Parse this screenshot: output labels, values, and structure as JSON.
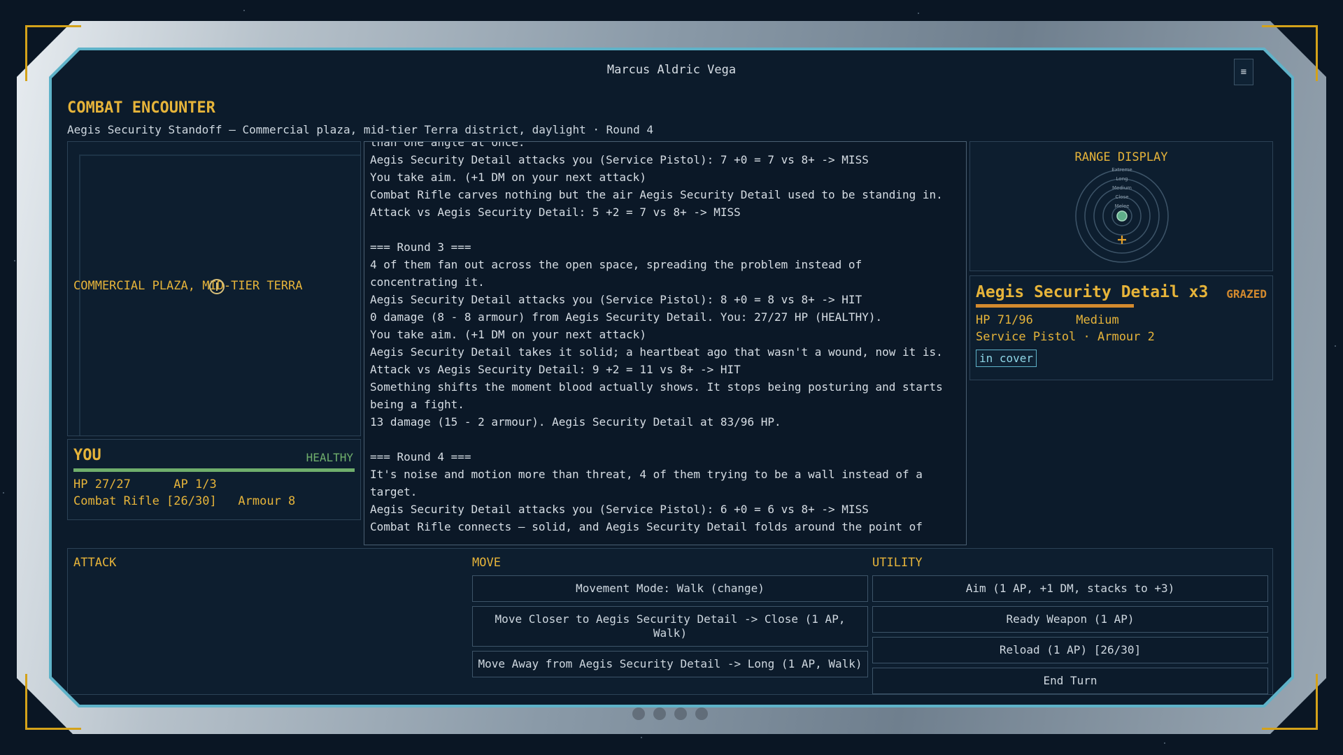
{
  "window": {
    "title": "Marcus Aldric Vega",
    "menu_glyph": "≡"
  },
  "encounter": {
    "title": "COMBAT ENCOUNTER",
    "subtitle": "Aegis Security Standoff — Commercial plaza, mid-tier Terra district, daylight · Round 4"
  },
  "map": {
    "label": "COMMERCIAL PLAZA, MID-TIER TERRA"
  },
  "player": {
    "title": "YOU",
    "status": "HEALTHY",
    "hp_fraction": 1.0,
    "line1": "HP 27/27      AP 1/3",
    "line2": "Combat Rifle [26/30]   Armour 8"
  },
  "log": [
    "than one angle at once.",
    "Aegis Security Detail attacks you (Service Pistol): 7 +0 = 7 vs 8+ -> MISS",
    "You take aim. (+1 DM on your next attack)",
    "Combat Rifle carves nothing but the air Aegis Security Detail used to be standing in.",
    "Attack vs Aegis Security Detail: 5 +2 = 7 vs 8+ -> MISS",
    "",
    "=== Round 3 ===",
    "4 of them fan out across the open space, spreading the problem instead of concentrating it.",
    "Aegis Security Detail attacks you (Service Pistol): 8 +0 = 8 vs 8+ -> HIT",
    "0 damage (8 - 8 armour) from Aegis Security Detail. You: 27/27 HP (HEALTHY).",
    "You take aim. (+1 DM on your next attack)",
    "Aegis Security Detail takes it solid; a heartbeat ago that wasn't a wound, now it is.",
    "Attack vs Aegis Security Detail: 9 +2 = 11 vs 8+ -> HIT",
    "Something shifts the moment blood actually shows. It stops being posturing and starts being a fight.",
    "13 damage (15 - 2 armour). Aegis Security Detail at 83/96 HP.",
    "",
    "=== Round 4 ===",
    "It's noise and motion more than threat, 4 of them trying to be a wall instead of a target.",
    "Aegis Security Detail attacks you (Service Pistol): 6 +0 = 6 vs 8+ -> MISS",
    "Combat Rifle connects — solid, and Aegis Security Detail folds around the point of"
  ],
  "range": {
    "title": "RANGE DISPLAY",
    "bands": [
      "Extreme",
      "Long",
      "Medium",
      "Close",
      "Melee"
    ]
  },
  "enemy": {
    "name": "Aegis Security Detail x3",
    "status": "GRAZED",
    "hp_fraction": 0.74,
    "line1": "HP 71/96      Medium",
    "line2": "Service Pistol · Armour 2",
    "badge": "in cover"
  },
  "actions": {
    "attack": {
      "heading": "ATTACK",
      "buttons": []
    },
    "move": {
      "heading": "MOVE",
      "buttons": [
        "Movement Mode: Walk (change)",
        "Move Closer to Aegis Security Detail -> Close (1 AP, Walk)",
        "Move Away from Aegis Security Detail -> Long (1 AP, Walk)"
      ]
    },
    "utility": {
      "heading": "UTILITY",
      "buttons": [
        "Aim (1 AP, +1 DM, stacks to +3)",
        "Ready Weapon (1 AP)",
        "Reload (1 AP) [26/30]",
        "End Turn"
      ]
    }
  },
  "colors": {
    "accent": "#e6b43a",
    "healthy": "#6fae6c",
    "grazed": "#d38a2e",
    "cyan": "#5fb3c9"
  }
}
